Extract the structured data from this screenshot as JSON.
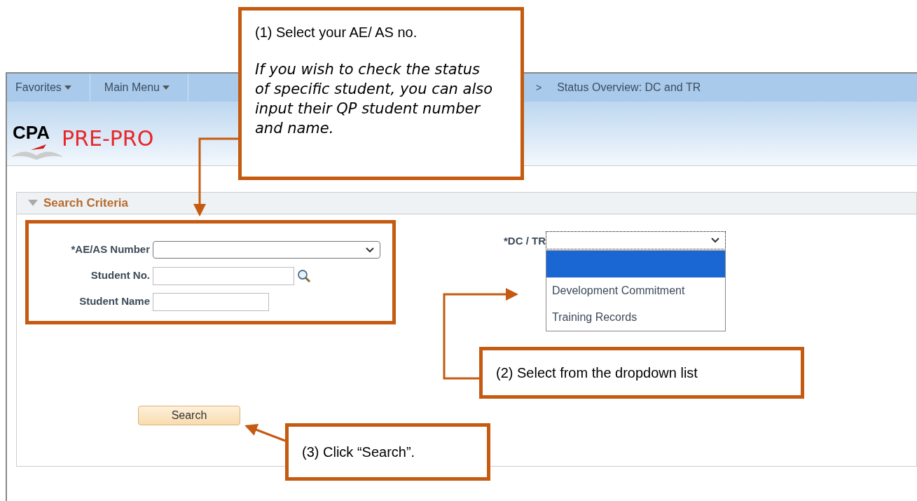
{
  "nav": {
    "menus": [
      {
        "label": "Favorites"
      },
      {
        "label": "Main Menu"
      }
    ],
    "breadcrumb": {
      "separator": ">",
      "label": "Status Overview: DC and TR"
    }
  },
  "logo": {
    "mark": "CPA",
    "title": "PRE-PRO"
  },
  "section": {
    "title": "Search Criteria",
    "expanded": true
  },
  "fields": [
    {
      "label": "*AE/AS Number",
      "kind": "select"
    },
    {
      "label": "Student No.",
      "kind": "lookup"
    },
    {
      "label": "Student Name",
      "kind": "text"
    }
  ],
  "dc_tr": {
    "label": "*DC / TR",
    "options": [
      {
        "selected": true
      },
      {
        "label": "Development Commitment",
        "selected": false
      },
      {
        "label": "Training Records",
        "selected": false
      }
    ]
  },
  "search_button": "Search",
  "callouts": [
    {
      "text": "(1) Select your AE/ AS no.",
      "note": "If you wish to check the status of specific student, you can also input their QP student number and name."
    },
    {
      "text": "(2) Select from the dropdown list"
    },
    {
      "text": "(3) Click “Search”."
    }
  ]
}
